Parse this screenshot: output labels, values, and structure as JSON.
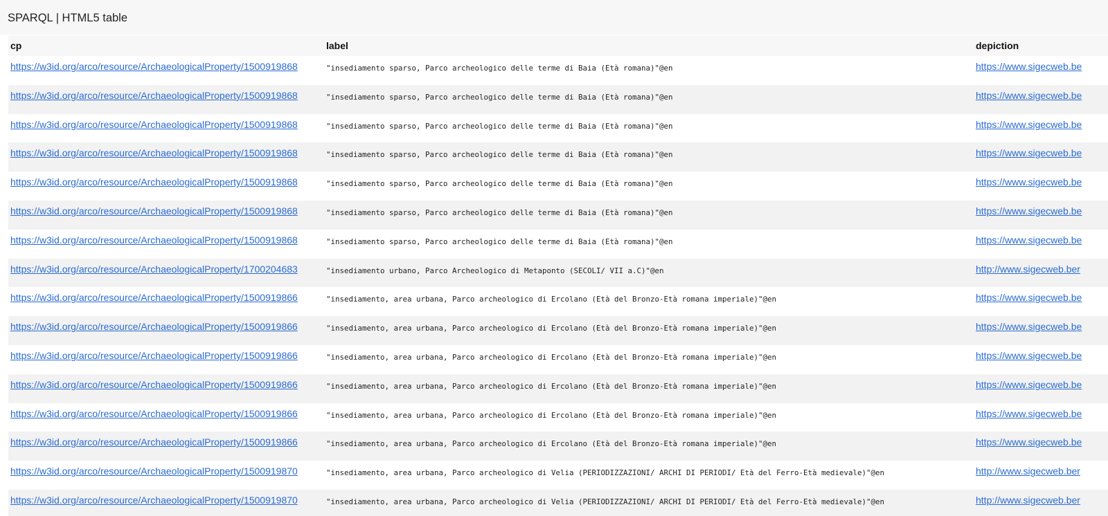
{
  "page": {
    "title": "SPARQL | HTML5 table"
  },
  "table": {
    "columns": [
      "cp",
      "label",
      "depiction"
    ],
    "rows": [
      {
        "cp": "https://w3id.org/arco/resource/ArchaeologicalProperty/1500919868",
        "label": "\"insediamento sparso, Parco archeologico delle terme di Baia (Età romana)\"@en",
        "depiction": "https://www.sigecweb.be"
      },
      {
        "cp": "https://w3id.org/arco/resource/ArchaeologicalProperty/1500919868",
        "label": "\"insediamento sparso, Parco archeologico delle terme di Baia (Età romana)\"@en",
        "depiction": "https://www.sigecweb.be"
      },
      {
        "cp": "https://w3id.org/arco/resource/ArchaeologicalProperty/1500919868",
        "label": "\"insediamento sparso, Parco archeologico delle terme di Baia (Età romana)\"@en",
        "depiction": "https://www.sigecweb.be"
      },
      {
        "cp": "https://w3id.org/arco/resource/ArchaeologicalProperty/1500919868",
        "label": "\"insediamento sparso, Parco archeologico delle terme di Baia (Età romana)\"@en",
        "depiction": "https://www.sigecweb.be"
      },
      {
        "cp": "https://w3id.org/arco/resource/ArchaeologicalProperty/1500919868",
        "label": "\"insediamento sparso, Parco archeologico delle terme di Baia (Età romana)\"@en",
        "depiction": "https://www.sigecweb.be"
      },
      {
        "cp": "https://w3id.org/arco/resource/ArchaeologicalProperty/1500919868",
        "label": "\"insediamento sparso, Parco archeologico delle terme di Baia (Età romana)\"@en",
        "depiction": "https://www.sigecweb.be"
      },
      {
        "cp": "https://w3id.org/arco/resource/ArchaeologicalProperty/1500919868",
        "label": "\"insediamento sparso, Parco archeologico delle terme di Baia (Età romana)\"@en",
        "depiction": "https://www.sigecweb.be"
      },
      {
        "cp": "https://w3id.org/arco/resource/ArchaeologicalProperty/1700204683",
        "label": "\"insediamento urbano, Parco Archeologico di Metaponto (SECOLI/ VII a.C)\"@en",
        "depiction": "http://www.sigecweb.ber"
      },
      {
        "cp": "https://w3id.org/arco/resource/ArchaeologicalProperty/1500919866",
        "label": "\"insediamento, area urbana, Parco archeologico di Ercolano (Età del Bronzo-Età romana imperiale)\"@en",
        "depiction": "https://www.sigecweb.be"
      },
      {
        "cp": "https://w3id.org/arco/resource/ArchaeologicalProperty/1500919866",
        "label": "\"insediamento, area urbana, Parco archeologico di Ercolano (Età del Bronzo-Età romana imperiale)\"@en",
        "depiction": "https://www.sigecweb.be"
      },
      {
        "cp": "https://w3id.org/arco/resource/ArchaeologicalProperty/1500919866",
        "label": "\"insediamento, area urbana, Parco archeologico di Ercolano (Età del Bronzo-Età romana imperiale)\"@en",
        "depiction": "https://www.sigecweb.be"
      },
      {
        "cp": "https://w3id.org/arco/resource/ArchaeologicalProperty/1500919866",
        "label": "\"insediamento, area urbana, Parco archeologico di Ercolano (Età del Bronzo-Età romana imperiale)\"@en",
        "depiction": "https://www.sigecweb.be"
      },
      {
        "cp": "https://w3id.org/arco/resource/ArchaeologicalProperty/1500919866",
        "label": "\"insediamento, area urbana, Parco archeologico di Ercolano (Età del Bronzo-Età romana imperiale)\"@en",
        "depiction": "https://www.sigecweb.be"
      },
      {
        "cp": "https://w3id.org/arco/resource/ArchaeologicalProperty/1500919866",
        "label": "\"insediamento, area urbana, Parco archeologico di Ercolano (Età del Bronzo-Età romana imperiale)\"@en",
        "depiction": "https://www.sigecweb.be"
      },
      {
        "cp": "https://w3id.org/arco/resource/ArchaeologicalProperty/1500919870",
        "label": "\"insediamento, area urbana, Parco archeologico di Velia (PERIODIZZAZIONI/ ARCHI DI PERIODI/ Età del Ferro-Età medievale)\"@en",
        "depiction": "http://www.sigecweb.ber"
      },
      {
        "cp": "https://w3id.org/arco/resource/ArchaeologicalProperty/1500919870",
        "label": "\"insediamento, area urbana, Parco archeologico di Velia (PERIODIZZAZIONI/ ARCHI DI PERIODI/ Età del Ferro-Età medievale)\"@en",
        "depiction": "http://www.sigecweb.ber"
      }
    ]
  }
}
